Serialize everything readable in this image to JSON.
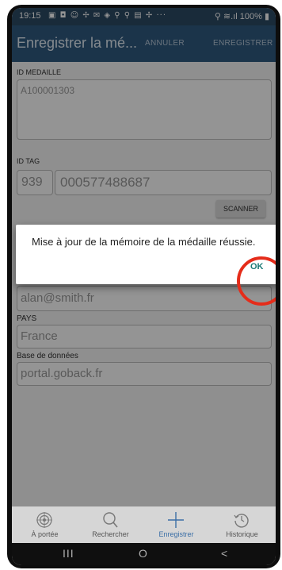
{
  "status_bar": {
    "time": "19:15",
    "icons": "▣ ◘ ☺ ✢ ✉ ◈ ⚲ ⚲ ▤ ✢ ···",
    "right": "⚲ ≋.ıl 100% ▮"
  },
  "app_bar": {
    "title": "Enregistrer la mé...",
    "cancel_label": "ANNULER",
    "save_label": "ENREGISTRER"
  },
  "form": {
    "medal_id": {
      "label": "ID MEDAILLE",
      "value": "A100001303"
    },
    "tag_id": {
      "label": "ID TAG",
      "prefix": "939",
      "value": "000577488687",
      "scan_label": "SCANNER"
    },
    "email": {
      "value": "alan@smith.fr"
    },
    "country": {
      "label": "PAYS",
      "value": "France"
    },
    "database": {
      "label": "Base de données",
      "value": "portal.goback.fr"
    }
  },
  "dialog": {
    "message": "Mise à jour de la mémoire de la médaille réussie.",
    "ok_label": "OK"
  },
  "annotation": {
    "color": "#e52c1a"
  },
  "bottom_nav": {
    "items": [
      {
        "label": "À portée",
        "icon": "radar-icon"
      },
      {
        "label": "Rechercher",
        "icon": "search-icon"
      },
      {
        "label": "Enregistrer",
        "icon": "plus-icon",
        "active": true
      },
      {
        "label": "Historique",
        "icon": "history-icon"
      }
    ]
  },
  "system_nav": {
    "recents": "III",
    "home": "O",
    "back": "<"
  }
}
